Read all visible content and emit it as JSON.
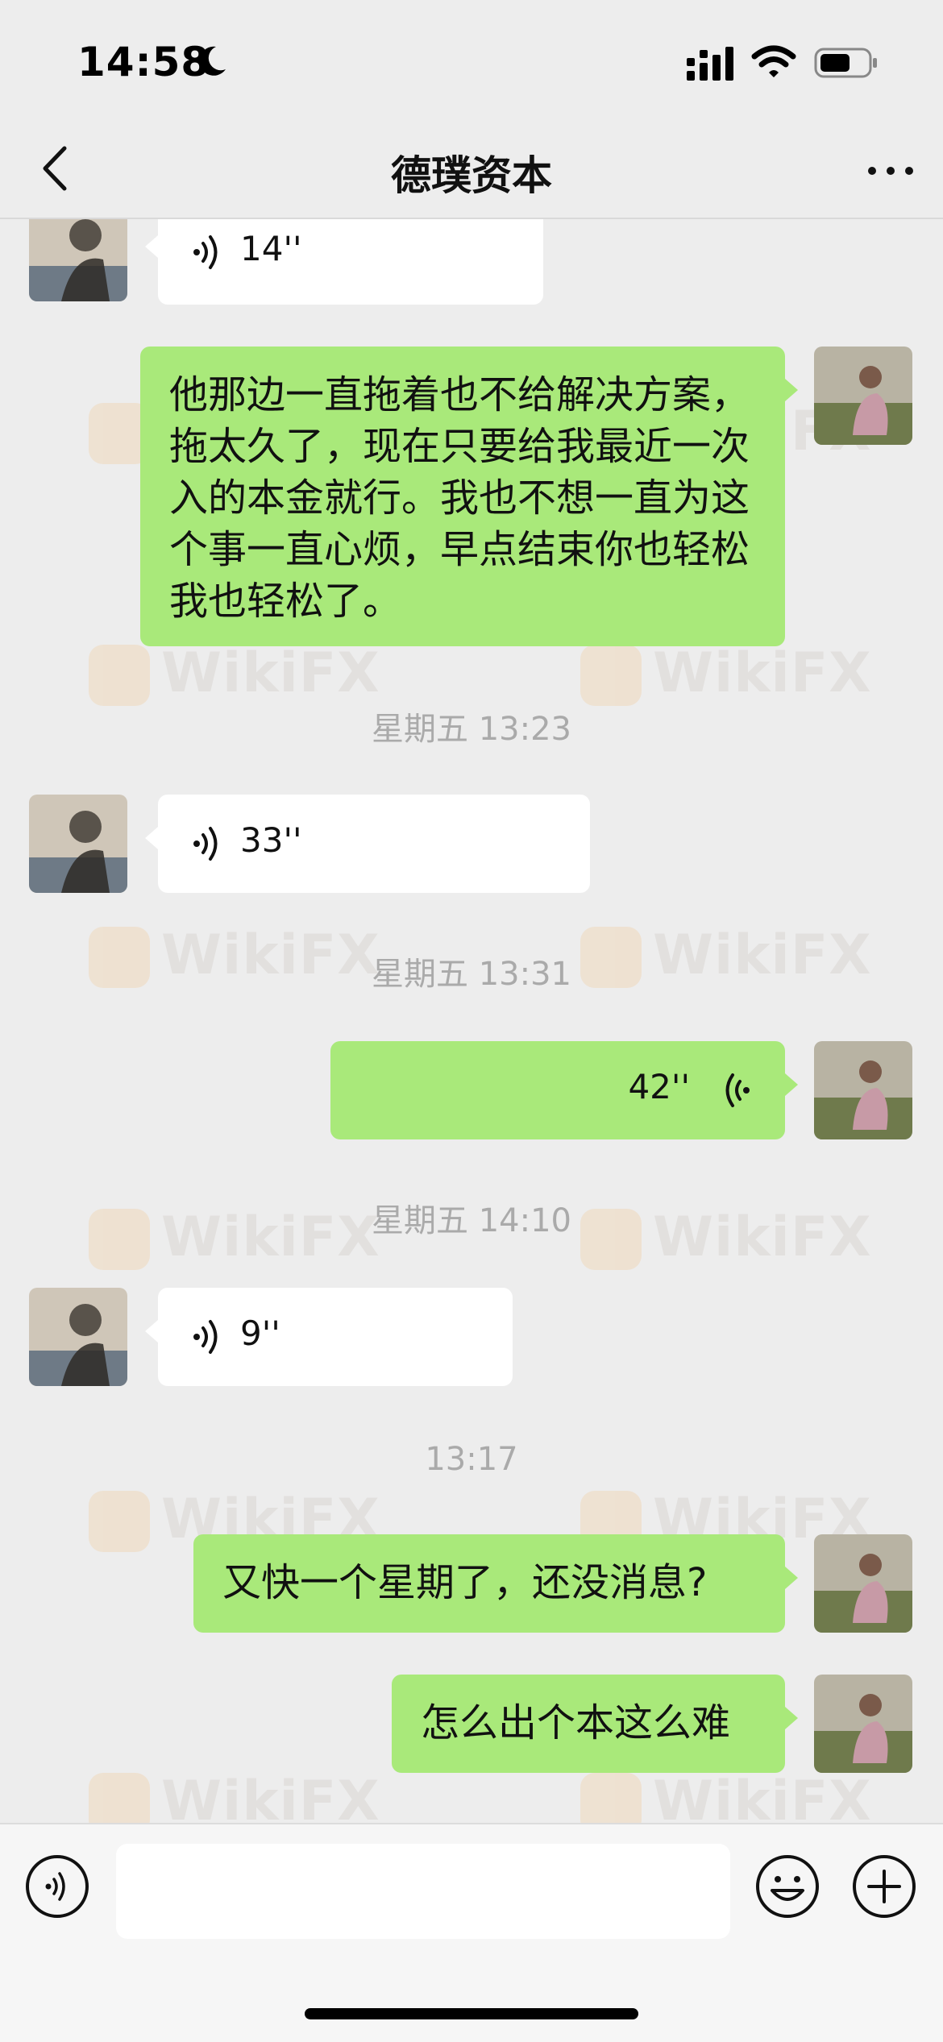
{
  "status_bar": {
    "time": "14:58"
  },
  "header": {
    "title": "德璞资本"
  },
  "messages": [
    {
      "type": "voice",
      "direction": "in",
      "duration": "14''"
    },
    {
      "type": "text",
      "direction": "out",
      "text": "他那边一直拖着也不给解决方案，拖太久了，现在只要给我最近一次入的本金就行。我也不想一直为这个事一直心烦，早点结束你也轻松我也轻松了。"
    },
    {
      "type": "timestamp",
      "text": "星期五 13:23"
    },
    {
      "type": "voice",
      "direction": "in",
      "duration": "33''"
    },
    {
      "type": "timestamp",
      "text": "星期五 13:31"
    },
    {
      "type": "voice",
      "direction": "out",
      "duration": "42''"
    },
    {
      "type": "timestamp",
      "text": "星期五 14:10"
    },
    {
      "type": "voice",
      "direction": "in",
      "duration": "9''"
    },
    {
      "type": "timestamp",
      "text": "13:17"
    },
    {
      "type": "text",
      "direction": "out",
      "text": "又快一个星期了，还没消息?"
    },
    {
      "type": "text",
      "direction": "out",
      "text": "怎么出个本这么难"
    }
  ],
  "watermark": {
    "text": "WikiFX"
  },
  "input": {
    "value": ""
  },
  "colors": {
    "background": "#ededed",
    "outgoing_bubble": "#a9e97a",
    "incoming_bubble": "#ffffff",
    "timestamp": "#aaaaaa"
  },
  "icons": [
    "moon-icon",
    "signal-icon",
    "wifi-icon",
    "battery-icon",
    "back-arrow-icon",
    "more-icon",
    "voice-wave-icon",
    "voice-toggle-icon",
    "emoji-icon",
    "plus-icon"
  ]
}
